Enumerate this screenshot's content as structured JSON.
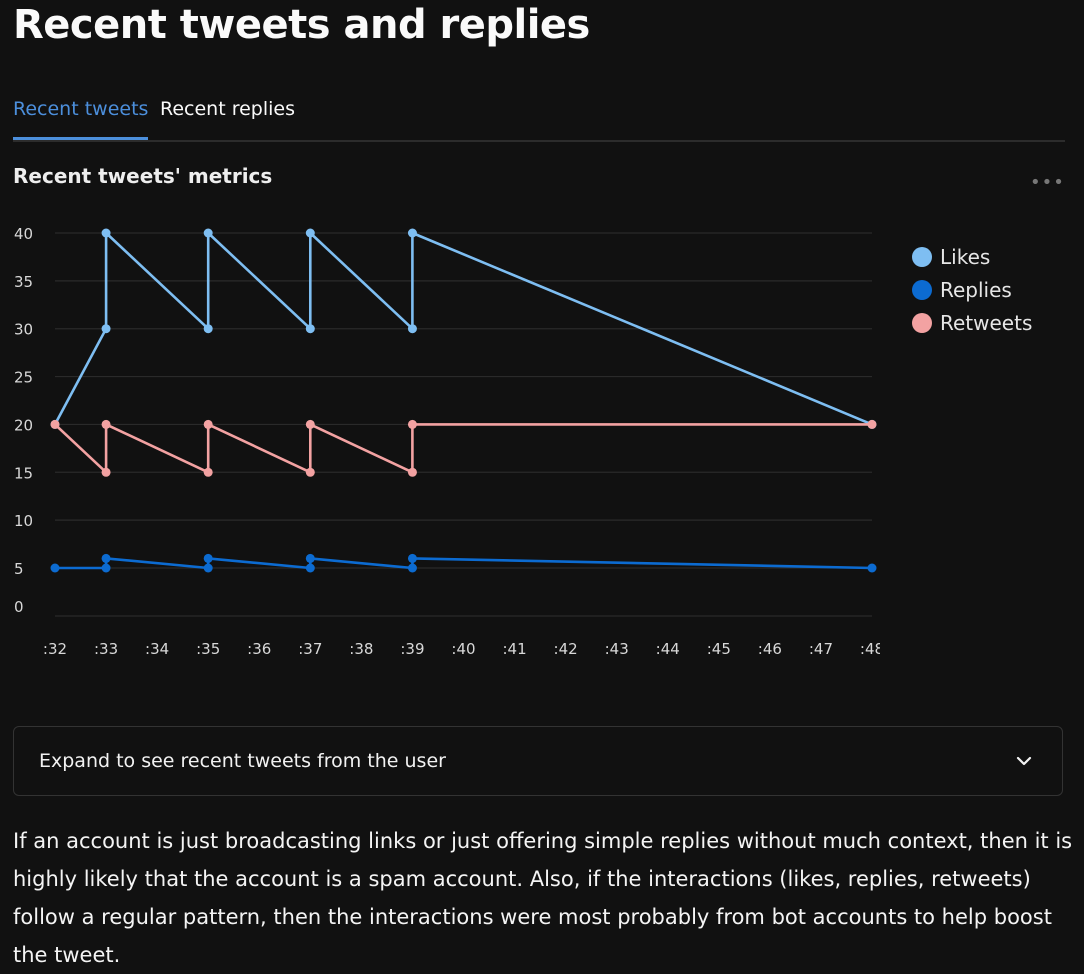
{
  "page": {
    "title": "Recent tweets and replies"
  },
  "tabs": [
    {
      "label": "Recent tweets",
      "active": true
    },
    {
      "label": "Recent replies",
      "active": false
    }
  ],
  "chart": {
    "title": "Recent tweets' metrics",
    "more_icon": "ellipsis-icon"
  },
  "chart_data": {
    "type": "line",
    "title": "Recent tweets' metrics",
    "xlabel": "",
    "ylabel": "",
    "x_ticks": [
      ":32",
      ":33",
      ":34",
      ":35",
      ":36",
      ":37",
      ":38",
      ":39",
      ":40",
      ":41",
      ":42",
      ":43",
      ":44",
      ":45",
      ":46",
      ":47",
      ":48"
    ],
    "y_ticks": [
      0,
      5,
      10,
      15,
      20,
      25,
      30,
      35,
      40
    ],
    "xlim": [
      32,
      48
    ],
    "ylim": [
      0,
      40
    ],
    "grid": true,
    "legend_position": "right",
    "series": [
      {
        "name": "Likes",
        "color": "#7ebef2",
        "points": [
          [
            32,
            20
          ],
          [
            33,
            30
          ],
          [
            33,
            40
          ],
          [
            35,
            30
          ],
          [
            35,
            40
          ],
          [
            37,
            30
          ],
          [
            37,
            40
          ],
          [
            39,
            30
          ],
          [
            39,
            40
          ],
          [
            48,
            20
          ]
        ]
      },
      {
        "name": "Replies",
        "color": "#0c6bd1",
        "points": [
          [
            32,
            5
          ],
          [
            33,
            5
          ],
          [
            33,
            6
          ],
          [
            35,
            5
          ],
          [
            35,
            6
          ],
          [
            37,
            5
          ],
          [
            37,
            6
          ],
          [
            39,
            5
          ],
          [
            39,
            6
          ],
          [
            48,
            5
          ]
        ]
      },
      {
        "name": "Retweets",
        "color": "#f3a2a2",
        "points": [
          [
            32,
            20
          ],
          [
            33,
            15
          ],
          [
            33,
            20
          ],
          [
            35,
            15
          ],
          [
            35,
            20
          ],
          [
            37,
            15
          ],
          [
            37,
            20
          ],
          [
            39,
            15
          ],
          [
            39,
            20
          ],
          [
            48,
            20
          ]
        ]
      }
    ]
  },
  "expander": {
    "label": "Expand to see recent tweets from the user",
    "icon": "chevron-down-icon"
  },
  "description": "If an account is just broadcasting links or just offering simple replies without much context, then it is highly likely that the account is a spam account. Also, if the interactions (likes, replies, retweets) follow a regular pattern, then the interactions were most probably from bot accounts to help boost the tweet."
}
